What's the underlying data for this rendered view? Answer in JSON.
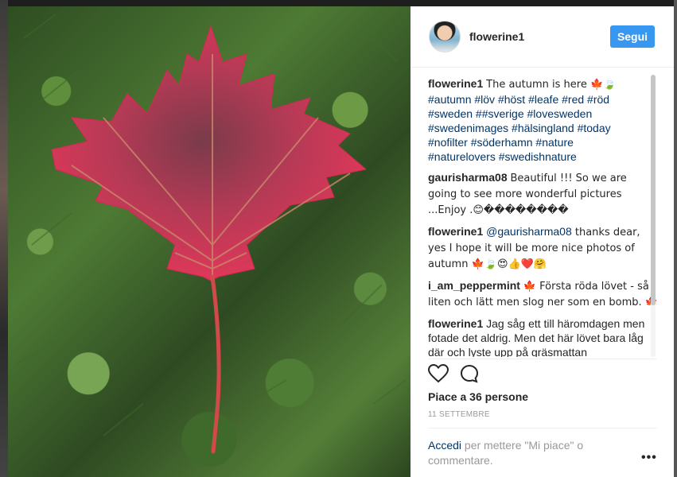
{
  "post": {
    "author": "flowerine1",
    "follow_label": "Segui",
    "photo_alt": "Red maple leaf on grass"
  },
  "caption": {
    "user": "flowerine1",
    "text": "The autumn is here 🍁🍃",
    "tags_line1": "#autumn #löv #höst #leafe #red #röd",
    "tags_line2": "#sweden ##sverige #lovesweden",
    "tags_line3": "#swedenimages #hälsingland #today",
    "tags_line4": "#nofilter #söderhamn #nature",
    "tags_line5": "#naturelovers #swedishnature"
  },
  "comments": [
    {
      "user": "gaurisharma08",
      "text": "Beautiful !!! So we are going to see more wonderful pictures ...Enjoy .😊��������"
    },
    {
      "user": "flowerine1",
      "mention": "@gaurisharma08",
      "text": " thanks dear, yes I hope it will be more nice photos of autumn 🍁🍃😍👍❤️🤗"
    },
    {
      "user": "i_am_peppermint",
      "text": "🍁 Första röda lövet - så liten och lätt men slog ner som en bomb. 🍁"
    },
    {
      "user": "flowerine1",
      "text": "Jag såg ett till häromdagen men fotade det aldrig. Men det här lövet bara låg där och lyste upp på gräsmattan"
    }
  ],
  "actions": {
    "like_icon": "heart-icon",
    "comment_icon": "comment-icon"
  },
  "likes_text": "Piace a 36 persone",
  "date_text": "11 SETTEMBRE",
  "login": {
    "link": "Accedi",
    "rest": " per mettere \"Mi piace\" o commentare."
  },
  "more_label": "•••",
  "colors": {
    "accent": "#3897f0",
    "link": "#003569",
    "muted": "#999999"
  }
}
